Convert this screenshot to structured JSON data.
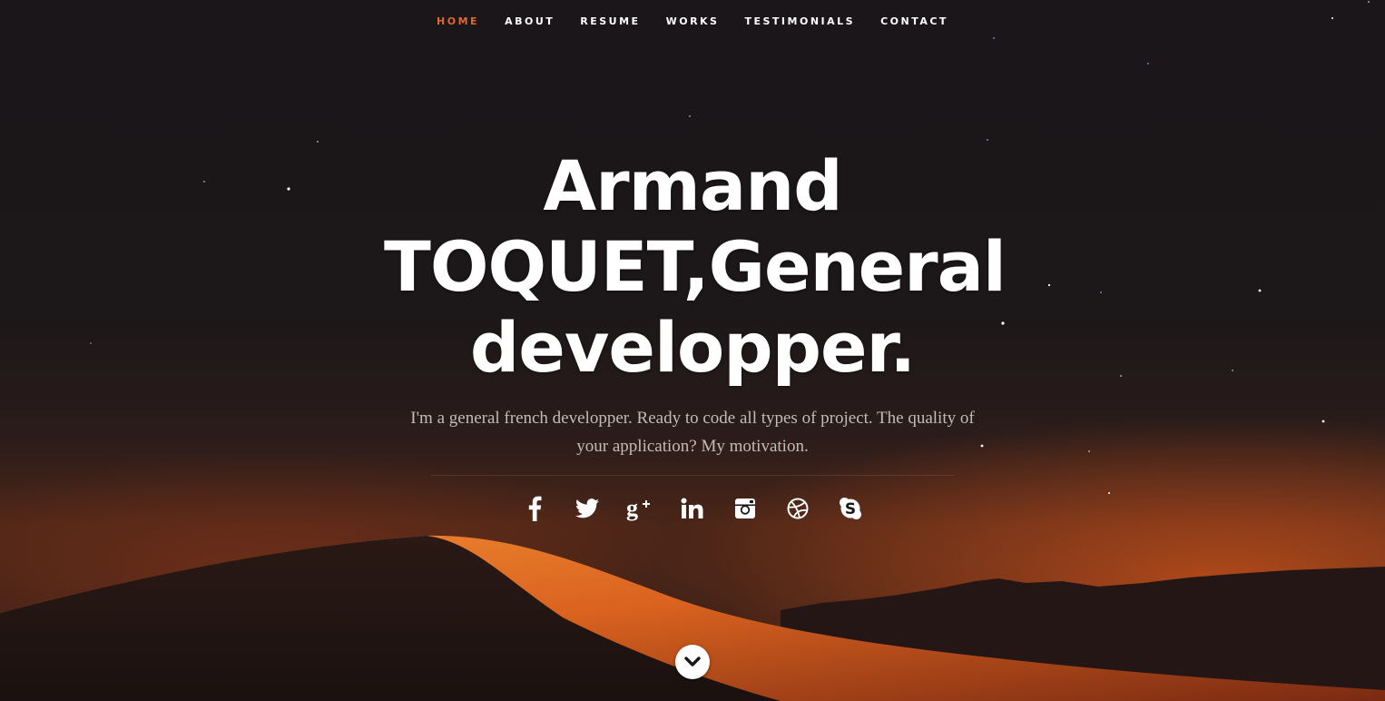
{
  "nav": {
    "items": [
      {
        "label": "HOME",
        "active": true
      },
      {
        "label": "ABOUT",
        "active": false
      },
      {
        "label": "RESUME",
        "active": false
      },
      {
        "label": "WORKS",
        "active": false
      },
      {
        "label": "TESTIMONIALS",
        "active": false
      },
      {
        "label": "CONTACT",
        "active": false
      }
    ],
    "active_color": "#e2672c"
  },
  "banner": {
    "headline_lines": [
      "Armand",
      "TOQUET,General",
      "developper."
    ],
    "intro": "I'm a general french developper. Ready to code all types of project. The quality of your application? My motivation."
  },
  "social": {
    "icons": [
      "facebook-icon",
      "twitter-icon",
      "google-plus-icon",
      "linkedin-icon",
      "instagram-icon",
      "dribbble-icon",
      "skype-icon"
    ]
  },
  "scroll": {
    "icon": "chevron-down-icon"
  },
  "colors": {
    "background": "#1b1719",
    "dune_orange": "#e0702a",
    "text_white": "#ffffff",
    "intro_text": "#c4bcb8"
  }
}
